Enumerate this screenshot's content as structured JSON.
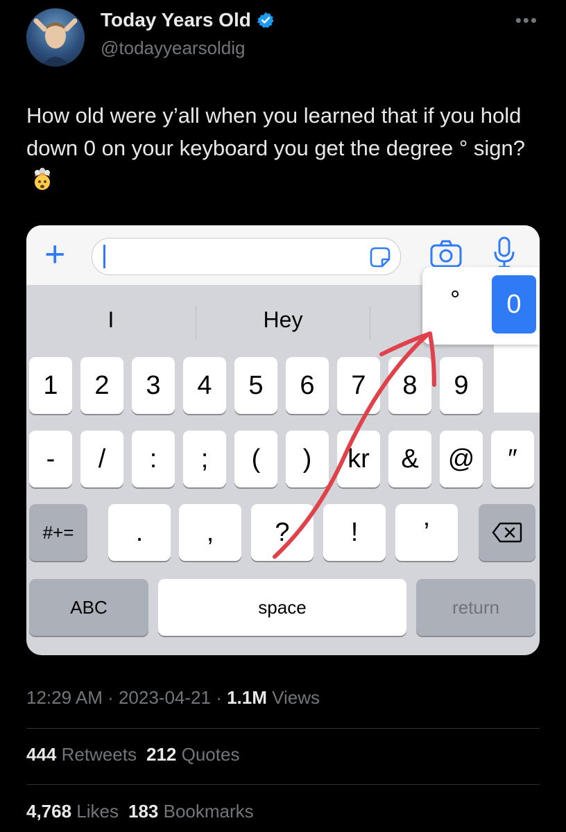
{
  "tweet": {
    "author_name": "Today Years Old",
    "handle": "@todayyearsoldig",
    "text": "How old were y’all when you learned that if you hold down 0 on your keyboard you get the degree ° sign?",
    "timestamp": "12:29 AM · 2023-04-21 · ",
    "views_count": "1.1M",
    "views_label": " Views",
    "retweets_count": "444",
    "retweets_label": " Retweets",
    "quotes_count": "212",
    "quotes_label": " Quotes",
    "likes_count": "4,768",
    "likes_label": " Likes",
    "bookmarks_count": "183",
    "bookmarks_label": " Bookmarks"
  },
  "icons": {
    "verified": "verified-badge-icon",
    "more": "more-options-icon",
    "emoji": "exploding-head-emoji",
    "plus": "plus-icon",
    "sticker": "sticker-icon",
    "camera": "camera-icon",
    "mic": "microphone-icon",
    "delete": "backspace-icon"
  },
  "keyboard": {
    "suggestions": [
      "I",
      "Hey"
    ],
    "row1": [
      "1",
      "2",
      "3",
      "4",
      "5",
      "6",
      "7",
      "8",
      "9"
    ],
    "row2": [
      "-",
      "/",
      ":",
      ";",
      "(",
      ")",
      "kr",
      "&",
      "@",
      "″"
    ],
    "row3": [
      ".",
      ",",
      "?",
      "!",
      "’"
    ],
    "shift_label": "#+=",
    "abc_label": "ABC",
    "space_label": "space",
    "return_label": "return",
    "popup_degree": "°",
    "popup_zero": "0"
  },
  "colors": {
    "background": "#000000",
    "accent_blue": "#2f7bf6",
    "verified_blue": "#1d9bf0",
    "annotation_red": "#e0424b"
  }
}
